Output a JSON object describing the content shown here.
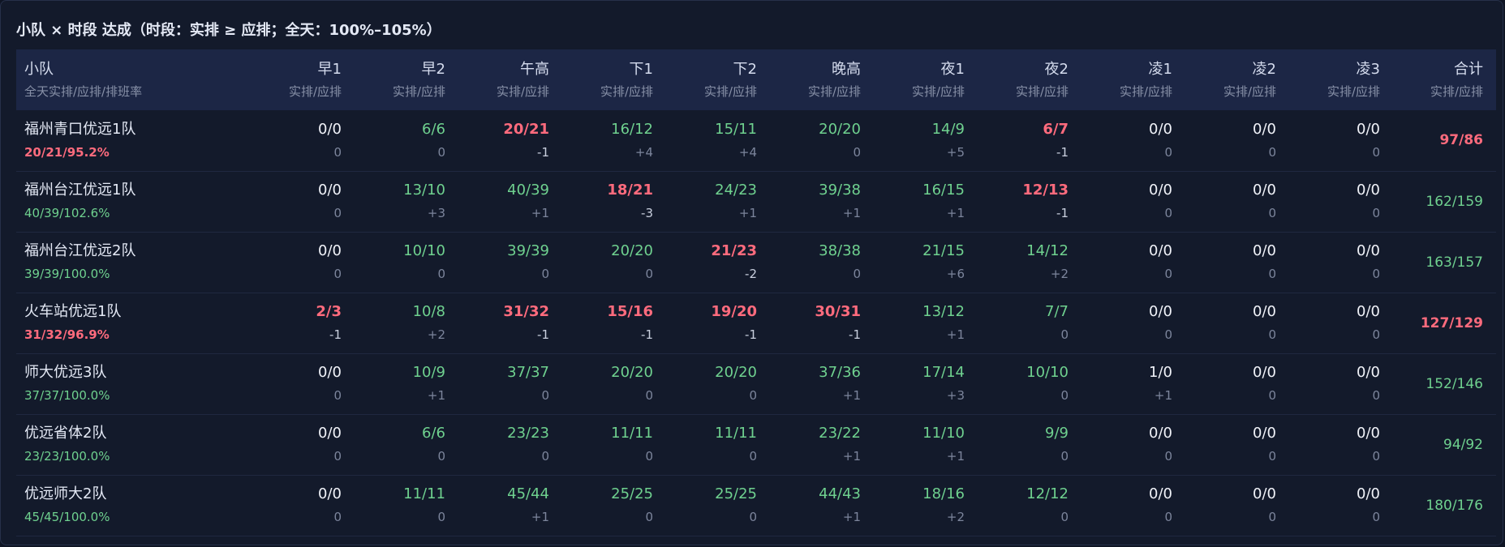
{
  "title": "小队 × 时段 达成（时段：实排 ≥ 应排；全天：100%–105%）",
  "colors": {
    "ok": "#6fd18f",
    "bad": "#ff6b7d",
    "zero": "#f0f2f8",
    "header_bg": "#1c2645"
  },
  "header": {
    "team_label": "小队",
    "team_sub": "全天实排/应排/排班率",
    "sub": "实排/应排",
    "slots": [
      "早1",
      "早2",
      "午高",
      "下1",
      "下2",
      "晚高",
      "夜1",
      "夜2",
      "凌1",
      "凌2",
      "凌3"
    ],
    "total": "合计"
  },
  "rows": [
    {
      "name": "福州青口优远1队",
      "rate": "20/21/95.2%",
      "rate_status": "bad",
      "cells": [
        {
          "v": "0/0",
          "d": "0",
          "s": "zero"
        },
        {
          "v": "6/6",
          "d": "0",
          "s": "ok"
        },
        {
          "v": "20/21",
          "d": "-1",
          "s": "bad"
        },
        {
          "v": "16/12",
          "d": "+4",
          "s": "ok"
        },
        {
          "v": "15/11",
          "d": "+4",
          "s": "ok"
        },
        {
          "v": "20/20",
          "d": "0",
          "s": "ok"
        },
        {
          "v": "14/9",
          "d": "+5",
          "s": "ok"
        },
        {
          "v": "6/7",
          "d": "-1",
          "s": "bad"
        },
        {
          "v": "0/0",
          "d": "0",
          "s": "zero"
        },
        {
          "v": "0/0",
          "d": "0",
          "s": "zero"
        },
        {
          "v": "0/0",
          "d": "0",
          "s": "zero"
        }
      ],
      "total": "97/86",
      "total_status": "bad"
    },
    {
      "name": "福州台江优远1队",
      "rate": "40/39/102.6%",
      "rate_status": "ok",
      "cells": [
        {
          "v": "0/0",
          "d": "0",
          "s": "zero"
        },
        {
          "v": "13/10",
          "d": "+3",
          "s": "ok"
        },
        {
          "v": "40/39",
          "d": "+1",
          "s": "ok"
        },
        {
          "v": "18/21",
          "d": "-3",
          "s": "bad"
        },
        {
          "v": "24/23",
          "d": "+1",
          "s": "ok"
        },
        {
          "v": "39/38",
          "d": "+1",
          "s": "ok"
        },
        {
          "v": "16/15",
          "d": "+1",
          "s": "ok"
        },
        {
          "v": "12/13",
          "d": "-1",
          "s": "bad"
        },
        {
          "v": "0/0",
          "d": "0",
          "s": "zero"
        },
        {
          "v": "0/0",
          "d": "0",
          "s": "zero"
        },
        {
          "v": "0/0",
          "d": "0",
          "s": "zero"
        }
      ],
      "total": "162/159",
      "total_status": "ok"
    },
    {
      "name": "福州台江优远2队",
      "rate": "39/39/100.0%",
      "rate_status": "ok",
      "cells": [
        {
          "v": "0/0",
          "d": "0",
          "s": "zero"
        },
        {
          "v": "10/10",
          "d": "0",
          "s": "ok"
        },
        {
          "v": "39/39",
          "d": "0",
          "s": "ok"
        },
        {
          "v": "20/20",
          "d": "0",
          "s": "ok"
        },
        {
          "v": "21/23",
          "d": "-2",
          "s": "bad"
        },
        {
          "v": "38/38",
          "d": "0",
          "s": "ok"
        },
        {
          "v": "21/15",
          "d": "+6",
          "s": "ok"
        },
        {
          "v": "14/12",
          "d": "+2",
          "s": "ok"
        },
        {
          "v": "0/0",
          "d": "0",
          "s": "zero"
        },
        {
          "v": "0/0",
          "d": "0",
          "s": "zero"
        },
        {
          "v": "0/0",
          "d": "0",
          "s": "zero"
        }
      ],
      "total": "163/157",
      "total_status": "ok"
    },
    {
      "name": "火车站优远1队",
      "rate": "31/32/96.9%",
      "rate_status": "bad",
      "cells": [
        {
          "v": "2/3",
          "d": "-1",
          "s": "bad"
        },
        {
          "v": "10/8",
          "d": "+2",
          "s": "ok"
        },
        {
          "v": "31/32",
          "d": "-1",
          "s": "bad"
        },
        {
          "v": "15/16",
          "d": "-1",
          "s": "bad"
        },
        {
          "v": "19/20",
          "d": "-1",
          "s": "bad"
        },
        {
          "v": "30/31",
          "d": "-1",
          "s": "bad"
        },
        {
          "v": "13/12",
          "d": "+1",
          "s": "ok"
        },
        {
          "v": "7/7",
          "d": "0",
          "s": "ok"
        },
        {
          "v": "0/0",
          "d": "0",
          "s": "zero"
        },
        {
          "v": "0/0",
          "d": "0",
          "s": "zero"
        },
        {
          "v": "0/0",
          "d": "0",
          "s": "zero"
        }
      ],
      "total": "127/129",
      "total_status": "bad"
    },
    {
      "name": "师大优远3队",
      "rate": "37/37/100.0%",
      "rate_status": "ok",
      "cells": [
        {
          "v": "0/0",
          "d": "0",
          "s": "zero"
        },
        {
          "v": "10/9",
          "d": "+1",
          "s": "ok"
        },
        {
          "v": "37/37",
          "d": "0",
          "s": "ok"
        },
        {
          "v": "20/20",
          "d": "0",
          "s": "ok"
        },
        {
          "v": "20/20",
          "d": "0",
          "s": "ok"
        },
        {
          "v": "37/36",
          "d": "+1",
          "s": "ok"
        },
        {
          "v": "17/14",
          "d": "+3",
          "s": "ok"
        },
        {
          "v": "10/10",
          "d": "0",
          "s": "ok"
        },
        {
          "v": "1/0",
          "d": "+1",
          "s": "zero"
        },
        {
          "v": "0/0",
          "d": "0",
          "s": "zero"
        },
        {
          "v": "0/0",
          "d": "0",
          "s": "zero"
        }
      ],
      "total": "152/146",
      "total_status": "ok"
    },
    {
      "name": "优远省体2队",
      "rate": "23/23/100.0%",
      "rate_status": "ok",
      "cells": [
        {
          "v": "0/0",
          "d": "0",
          "s": "zero"
        },
        {
          "v": "6/6",
          "d": "0",
          "s": "ok"
        },
        {
          "v": "23/23",
          "d": "0",
          "s": "ok"
        },
        {
          "v": "11/11",
          "d": "0",
          "s": "ok"
        },
        {
          "v": "11/11",
          "d": "0",
          "s": "ok"
        },
        {
          "v": "23/22",
          "d": "+1",
          "s": "ok"
        },
        {
          "v": "11/10",
          "d": "+1",
          "s": "ok"
        },
        {
          "v": "9/9",
          "d": "0",
          "s": "ok"
        },
        {
          "v": "0/0",
          "d": "0",
          "s": "zero"
        },
        {
          "v": "0/0",
          "d": "0",
          "s": "zero"
        },
        {
          "v": "0/0",
          "d": "0",
          "s": "zero"
        }
      ],
      "total": "94/92",
      "total_status": "ok"
    },
    {
      "name": "优远师大2队",
      "rate": "45/45/100.0%",
      "rate_status": "ok",
      "cells": [
        {
          "v": "0/0",
          "d": "0",
          "s": "zero"
        },
        {
          "v": "11/11",
          "d": "0",
          "s": "ok"
        },
        {
          "v": "45/44",
          "d": "+1",
          "s": "ok"
        },
        {
          "v": "25/25",
          "d": "0",
          "s": "ok"
        },
        {
          "v": "25/25",
          "d": "0",
          "s": "ok"
        },
        {
          "v": "44/43",
          "d": "+1",
          "s": "ok"
        },
        {
          "v": "18/16",
          "d": "+2",
          "s": "ok"
        },
        {
          "v": "12/12",
          "d": "0",
          "s": "ok"
        },
        {
          "v": "0/0",
          "d": "0",
          "s": "zero"
        },
        {
          "v": "0/0",
          "d": "0",
          "s": "zero"
        },
        {
          "v": "0/0",
          "d": "0",
          "s": "zero"
        }
      ],
      "total": "180/176",
      "total_status": "ok"
    }
  ]
}
